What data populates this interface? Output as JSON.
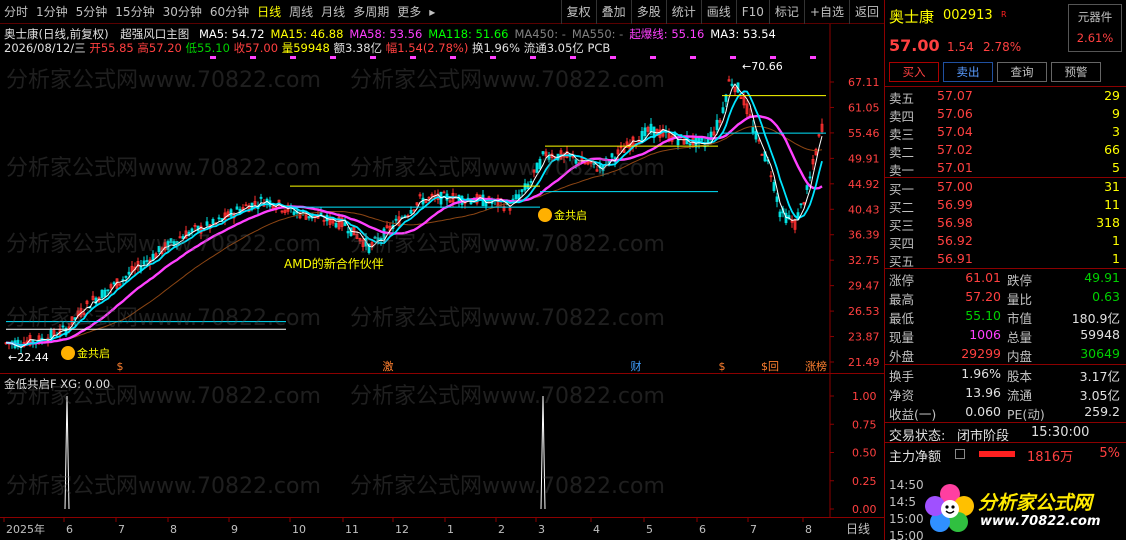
{
  "toolbar": {
    "periods": [
      "分时",
      "1分钟",
      "5分钟",
      "15分钟",
      "30分钟",
      "60分钟",
      "日线",
      "周线",
      "月线",
      "多周期",
      "更多"
    ],
    "active_period": "日线",
    "actions": [
      "复权",
      "叠加",
      "多股",
      "统计",
      "画线",
      "F10",
      "标记",
      "+自选",
      "返回"
    ]
  },
  "main_chart": {
    "title_line": "奥士康(日线,前复权)",
    "indicator": "超强风口主图",
    "ma": [
      {
        "label": "MA5: 54.72",
        "color": "#ffffff"
      },
      {
        "label": "MA15: 46.88",
        "color": "#ffff00"
      },
      {
        "label": "MA58: 53.56",
        "color": "#ff40ff"
      },
      {
        "label": "MA118: 51.66",
        "color": "#00ff00"
      },
      {
        "label": "MA450: -",
        "color": "#808080"
      },
      {
        "label": "MA550: -",
        "color": "#808080"
      },
      {
        "label": "起爆线: 55.16",
        "color": "#ff40ff"
      },
      {
        "label": "MA3: 53.54",
        "color": "#ffffff"
      }
    ],
    "bar_info": {
      "date": "2026/08/12/三",
      "open": "开55.85",
      "high": "高57.20",
      "low": "低55.10",
      "close": "收57.00",
      "vol": "量59948",
      "amount": "额3.38亿",
      "range": "幅1.54(2.78%)",
      "turnover": "换1.96%",
      "float": "流通3.05亿",
      "pcb": "PCB"
    },
    "y_ticks": [
      "67.11",
      "61.05",
      "55.46",
      "49.91",
      "44.92",
      "40.43",
      "36.39",
      "32.75",
      "29.47",
      "26.53",
      "23.87",
      "21.49"
    ],
    "annotations": {
      "high_label": "70.66",
      "low_label": "22.44",
      "event_text": "AMD的新合作伙伴",
      "gold_cross_1": "金共启",
      "gold_cross_2": "金共启"
    },
    "event_markers": [
      "$",
      "激",
      "财",
      "$",
      "$回",
      "涨榜"
    ]
  },
  "sub_chart": {
    "title": "金低共启F",
    "xg": "XG: 0.00",
    "y_ticks": [
      "1.00",
      "0.75",
      "0.50",
      "0.25",
      "0.00"
    ]
  },
  "x_axis": {
    "labels": [
      "2025年",
      "6",
      "7",
      "8",
      "9",
      "10",
      "11",
      "12",
      "1",
      "2",
      "3",
      "4",
      "5",
      "6",
      "7",
      "8"
    ],
    "period_label": "日线"
  },
  "quote": {
    "name": "奥士康",
    "code": "002913",
    "r_label": "R",
    "sector_name": "元器件",
    "sector_pct": "2.61%",
    "price": "57.00",
    "change": "1.54",
    "change_pct": "2.78%",
    "buttons": [
      "买入",
      "卖出",
      "查询",
      "预警"
    ],
    "asks": [
      {
        "label": "卖五",
        "price": "57.07",
        "vol": "29"
      },
      {
        "label": "卖四",
        "price": "57.06",
        "vol": "9"
      },
      {
        "label": "卖三",
        "price": "57.04",
        "vol": "3"
      },
      {
        "label": "卖二",
        "price": "57.02",
        "vol": "66"
      },
      {
        "label": "卖一",
        "price": "57.01",
        "vol": "5"
      }
    ],
    "bids": [
      {
        "label": "买一",
        "price": "57.00",
        "vol": "31"
      },
      {
        "label": "买二",
        "price": "56.99",
        "vol": "11"
      },
      {
        "label": "买三",
        "price": "56.98",
        "vol": "318"
      },
      {
        "label": "买四",
        "price": "56.92",
        "vol": "1"
      },
      {
        "label": "买五",
        "price": "56.91",
        "vol": "1"
      }
    ],
    "stats1": [
      {
        "l1": "涨停",
        "v1": "61.01",
        "c1": "red",
        "l2": "跌停",
        "v2": "49.91",
        "c2": "green"
      },
      {
        "l1": "最高",
        "v1": "57.20",
        "c1": "red",
        "l2": "量比",
        "v2": "0.63",
        "c2": "green"
      },
      {
        "l1": "最低",
        "v1": "55.10",
        "c1": "green",
        "l2": "市值",
        "v2": "180.9亿",
        "c2": "white"
      },
      {
        "l1": "现量",
        "v1": "1006",
        "c1": "purple",
        "l2": "总量",
        "v2": "59948",
        "c2": "white"
      },
      {
        "l1": "外盘",
        "v1": "29299",
        "c1": "red",
        "l2": "内盘",
        "v2": "30649",
        "c2": "green"
      }
    ],
    "stats2": [
      {
        "l1": "换手",
        "v1": "1.96%",
        "c1": "white",
        "l2": "股本",
        "v2": "3.17亿",
        "c2": "white"
      },
      {
        "l1": "净资",
        "v1": "13.96",
        "c1": "white",
        "l2": "流通",
        "v2": "3.05亿",
        "c2": "white"
      },
      {
        "l1": "收益(一)",
        "v1": "0.060",
        "c1": "white",
        "l2": "PE(动)",
        "v2": "259.2",
        "c2": "white"
      }
    ],
    "trade_state_label": "交易状态:",
    "trade_state": "闭市阶段",
    "trade_time": "15:30:00",
    "main_flow_label": "主力净额",
    "main_flow_value": "1816万",
    "main_flow_pct": "5%",
    "ticks": [
      "14:50",
      "14:5",
      "15:00",
      "15:00"
    ]
  },
  "logo": {
    "title": "分析家公式网",
    "url": "www.70822.com"
  },
  "watermarks": [
    "分析家公式网www.70822.com"
  ]
}
